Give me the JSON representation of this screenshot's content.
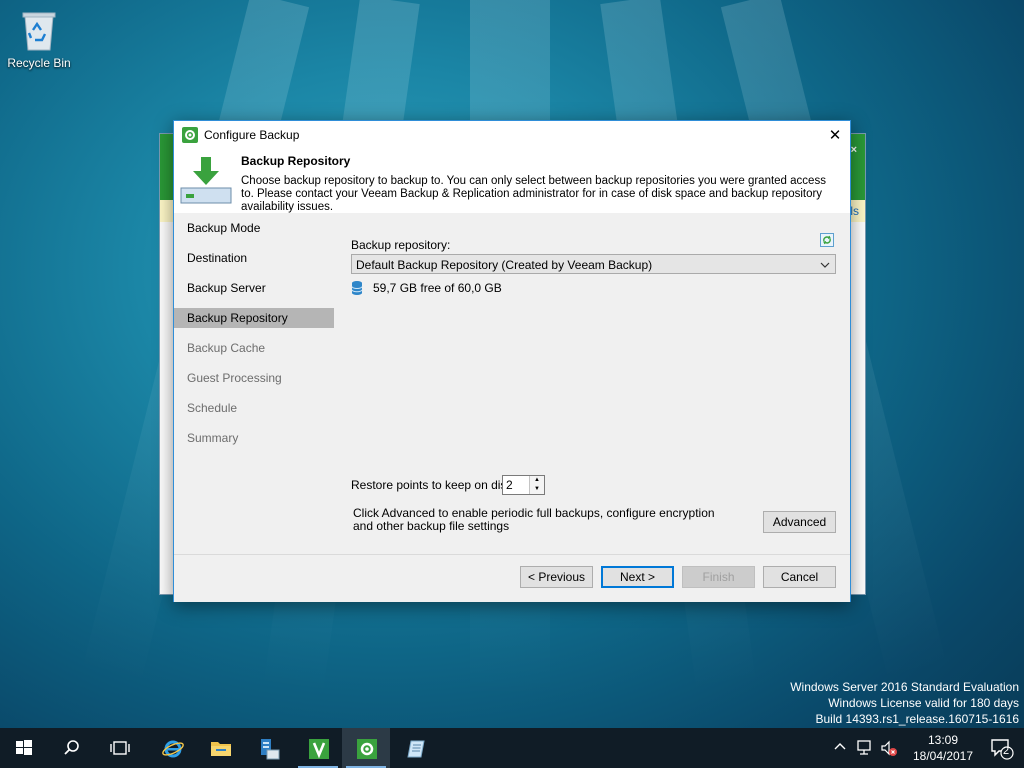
{
  "desktop": {
    "recycle_bin_label": "Recycle Bin"
  },
  "background_window": {
    "yellow_text": "ls",
    "close_glyph": "×"
  },
  "dialog": {
    "title": "Configure Backup",
    "close_glyph": "✕",
    "header": {
      "title": "Backup Repository",
      "description": "Choose backup repository to backup to. You can only select between backup repositories you were granted access to. Please contact your Veeam Backup & Replication administrator for in case of disk space and backup repository availability issues."
    },
    "steps": [
      {
        "label": "Backup Mode",
        "state": "done"
      },
      {
        "label": "Destination",
        "state": "done"
      },
      {
        "label": "Backup Server",
        "state": "done"
      },
      {
        "label": "Backup Repository",
        "state": "active"
      },
      {
        "label": "Backup Cache",
        "state": "pending"
      },
      {
        "label": "Guest Processing",
        "state": "pending"
      },
      {
        "label": "Schedule",
        "state": "pending"
      },
      {
        "label": "Summary",
        "state": "pending"
      }
    ],
    "repository_label": "Backup repository:",
    "repository_value": "Default Backup Repository (Created by Veeam Backup)",
    "free_space": "59,7 GB free of 60,0 GB",
    "restore_points_label": "Restore points to keep on disk",
    "restore_points_value": "2",
    "advanced_text": "Click Advanced to enable periodic full backups, configure encryption and other backup file settings",
    "buttons": {
      "advanced": "Advanced",
      "previous": "< Previous",
      "next": "Next >",
      "finish": "Finish",
      "cancel": "Cancel"
    }
  },
  "watermark": {
    "line1": "Windows Server 2016 Standard Evaluation",
    "line2": "Windows License valid for 180 days",
    "line3": "Build 14393.rs1_release.160715-1616"
  },
  "taskbar": {
    "clock_time": "13:09",
    "clock_date": "18/04/2017",
    "notification_count": "2"
  },
  "colors": {
    "accent": "#0078d7",
    "veeam_green": "#3aa23e",
    "taskbar": "#101c26"
  }
}
